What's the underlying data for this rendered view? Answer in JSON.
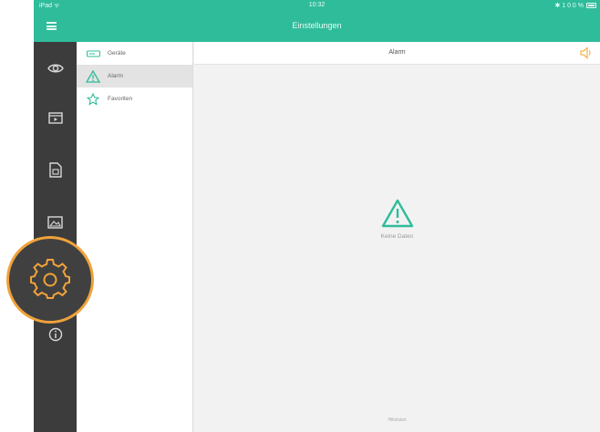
{
  "status_bar": {
    "carrier": "iPad ᯤ",
    "time": "10:32",
    "right": "✱ 1 0 0 %"
  },
  "title_bar": {
    "title": "Einstellungen",
    "menu_icon": "hamburger-icon"
  },
  "rail": {
    "items": [
      {
        "name": "live-view",
        "icon": "eye-icon"
      },
      {
        "name": "playback",
        "icon": "playback-icon"
      },
      {
        "name": "files",
        "icon": "files-icon"
      },
      {
        "name": "pictures",
        "icon": "pictures-icon"
      },
      {
        "name": "settings",
        "icon": "gear-icon",
        "highlighted": true
      },
      {
        "name": "info",
        "icon": "info-icon"
      }
    ]
  },
  "list": {
    "items": [
      {
        "label": "Geräte",
        "icon": "device-icon",
        "selected": false
      },
      {
        "label": "Alarm",
        "icon": "warning-icon",
        "selected": true
      },
      {
        "label": "Favoriten",
        "icon": "star-icon",
        "selected": false
      }
    ]
  },
  "content": {
    "title": "Alarm",
    "empty_text": "Keine Daten",
    "footer": "Hikvision",
    "speaker_icon": "speaker-icon"
  },
  "colors": {
    "accent": "#2fbc9b",
    "rail": "#3c3c3c",
    "highlight": "#f0a23a",
    "warning": "#f0b44a"
  }
}
